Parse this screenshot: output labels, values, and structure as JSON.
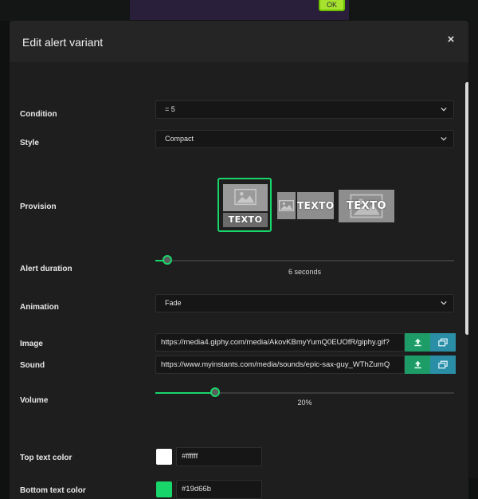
{
  "background": {
    "ok_label": "OK"
  },
  "modal": {
    "title": "Edit alert variant",
    "close_glyph": "×"
  },
  "form": {
    "condition": {
      "label": "Condition",
      "value": "= 5"
    },
    "style": {
      "label": "Style",
      "value": "Compact"
    },
    "provision": {
      "label": "Provision",
      "options": [
        {
          "text": "TEXTO",
          "selected": true
        },
        {
          "text": "TEXTO",
          "selected": false
        },
        {
          "text": "TEXTO",
          "selected": false
        }
      ]
    },
    "alert_duration": {
      "label": "Alert duration",
      "value_text": "6 seconds",
      "fraction": 0.04
    },
    "animation": {
      "label": "Animation",
      "value": "Fade"
    },
    "image": {
      "label": "Image",
      "value": "https://media4.giphy.com/media/AkovKBmyYumQ0EUOfR/giphy.gif?"
    },
    "sound": {
      "label": "Sound",
      "value": "https://www.myinstants.com/media/sounds/epic-sax-guy_WThZumQ"
    },
    "volume": {
      "label": "Volume",
      "value_text": "20%",
      "fraction": 0.2
    },
    "top_text_color": {
      "label": "Top text color",
      "value": "#ffffff",
      "swatch": "#ffffff"
    },
    "bottom_text_color": {
      "label": "Bottom text color",
      "value": "#19d66b",
      "swatch": "#19d66b"
    }
  },
  "icons": {
    "upload": "upload-icon",
    "gallery": "gallery-icon",
    "chevron": "chevron-down-icon",
    "close": "close-icon"
  },
  "colors": {
    "accent": "#19d66b",
    "upload_button": "#1e9c68",
    "gallery_button": "#2a8fa6"
  }
}
